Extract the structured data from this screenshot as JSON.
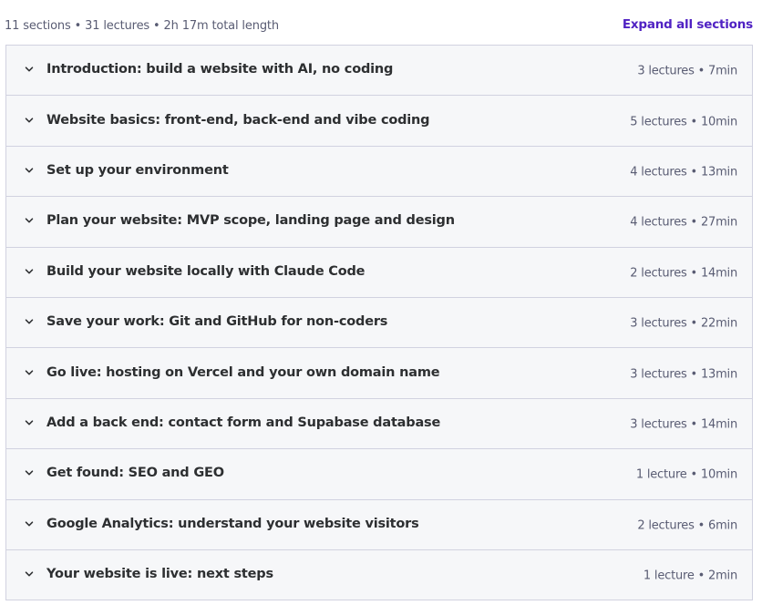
{
  "header": {
    "summary": "11 sections • 31 lectures • 2h 17m total length",
    "expand_all_label": "Expand all sections"
  },
  "colors": {
    "accent": "#5022c3",
    "section_bg": "#f6f7f9",
    "border": "#d1d2e0",
    "text": "#2d2f31",
    "muted_text": "#595c73"
  },
  "icons": {
    "section_toggle": "chevron-down-icon"
  },
  "sections": [
    {
      "title": "Introduction: build a website with AI, no coding",
      "meta": "3 lectures • 7min"
    },
    {
      "title": "Website basics: front-end, back-end and vibe coding",
      "meta": "5 lectures • 10min"
    },
    {
      "title": "Set up your environment",
      "meta": "4 lectures • 13min"
    },
    {
      "title": "Plan your website: MVP scope, landing page and design",
      "meta": "4 lectures • 27min"
    },
    {
      "title": "Build your website locally with Claude Code",
      "meta": "2 lectures • 14min"
    },
    {
      "title": "Save your work: Git and GitHub for non-coders",
      "meta": "3 lectures • 22min"
    },
    {
      "title": "Go live: hosting on Vercel and your own domain name",
      "meta": "3 lectures • 13min"
    },
    {
      "title": "Add a back end: contact form and Supabase database",
      "meta": "3 lectures • 14min"
    },
    {
      "title": "Get found: SEO and GEO",
      "meta": "1 lecture • 10min"
    },
    {
      "title": "Google Analytics: understand your website visitors",
      "meta": "2 lectures • 6min"
    },
    {
      "title": "Your website is live: next steps",
      "meta": "1 lecture • 2min"
    }
  ]
}
